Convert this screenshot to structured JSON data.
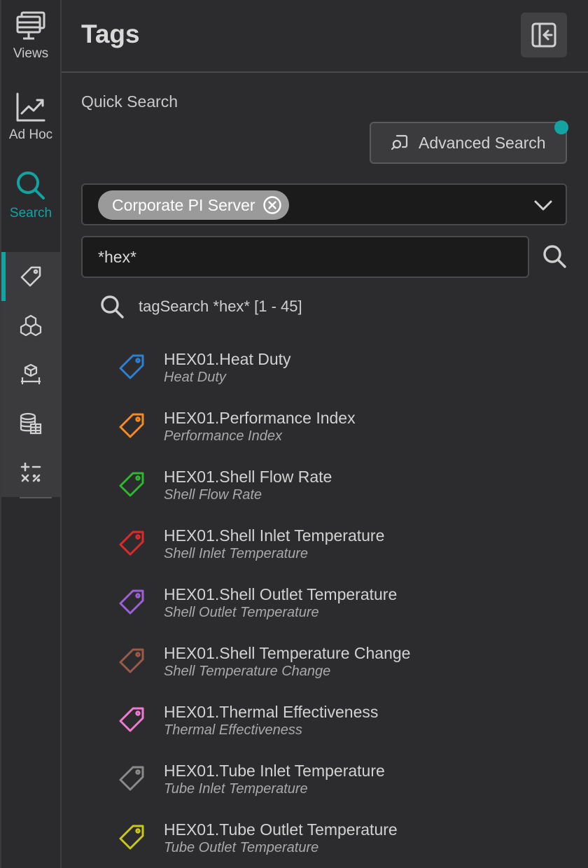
{
  "rail": {
    "items": [
      {
        "label": "Views",
        "icon": "monitor-icon"
      },
      {
        "label": "Ad Hoc",
        "icon": "chart-line-icon"
      },
      {
        "label": "Search",
        "icon": "search-icon"
      }
    ],
    "sub_items": [
      "tag-icon",
      "cubes-icon",
      "asset-icon",
      "database-icon",
      "calculator-icon"
    ]
  },
  "panel": {
    "title": "Tags",
    "quick_search_label": "Quick Search",
    "advanced_search_label": "Advanced Search",
    "server_chip": "Corporate PI Server",
    "search_value": "*hex*",
    "summary": "tagSearch *hex* [1 - 45]"
  },
  "colors": {
    "accent": "#13a3a3"
  },
  "results": [
    {
      "name": "HEX01.Heat Duty",
      "desc": "Heat Duty",
      "color": "#2f7fd0"
    },
    {
      "name": "HEX01.Performance Index",
      "desc": "Performance Index",
      "color": "#f58a1f"
    },
    {
      "name": "HEX01.Shell Flow Rate",
      "desc": "Shell Flow Rate",
      "color": "#2fb62f"
    },
    {
      "name": "HEX01.Shell Inlet Temperature",
      "desc": "Shell Inlet Temperature",
      "color": "#de2a2a"
    },
    {
      "name": "HEX01.Shell Outlet Temperature",
      "desc": "Shell Outlet Temperature",
      "color": "#9a62d2"
    },
    {
      "name": "HEX01.Shell Temperature Change",
      "desc": "Shell Temperature Change",
      "color": "#9a5a4a"
    },
    {
      "name": "HEX01.Thermal Effectiveness",
      "desc": "Thermal Effectiveness",
      "color": "#f07ad0"
    },
    {
      "name": "HEX01.Tube Inlet Temperature",
      "desc": "Tube Inlet Temperature",
      "color": "#8a8a8a"
    },
    {
      "name": "HEX01.Tube Outlet Temperature",
      "desc": "Tube Outlet Temperature",
      "color": "#c8c81a"
    }
  ]
}
